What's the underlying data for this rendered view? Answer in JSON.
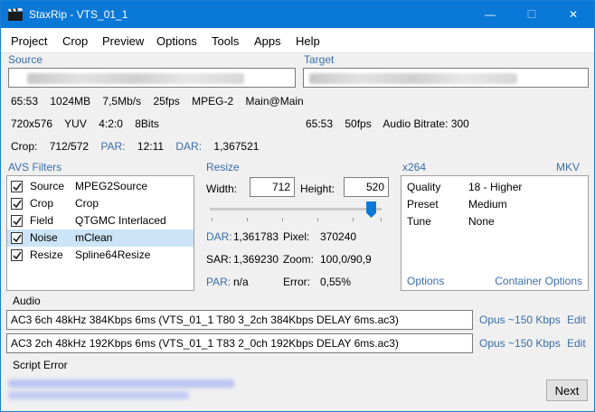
{
  "window": {
    "title": "StaxRip - VTS_01_1",
    "min_glyph": "—",
    "max_glyph": "☐",
    "close_glyph": "✕"
  },
  "menu": [
    "Project",
    "Crop",
    "Preview",
    "Options",
    "Tools",
    "Apps",
    "Help"
  ],
  "source": {
    "label": "Source",
    "line1": [
      "65:53",
      "1024MB",
      "7,5Mb/s",
      "25fps",
      "MPEG-2",
      "Main@Main"
    ],
    "line2": [
      "720x576",
      "YUV",
      "4:2:0",
      "8Bits"
    ],
    "crop_label": "Crop:",
    "crop_value": "712/572",
    "par_label": "PAR:",
    "par_value": "12:11",
    "dar_label": "DAR:",
    "dar_value": "1,367521"
  },
  "target": {
    "label": "Target",
    "info": [
      "65:53",
      "50fps",
      "Audio Bitrate: 300"
    ]
  },
  "filters": {
    "label": "AVS Filters",
    "rows": [
      {
        "name": "Source",
        "value": "MPEG2Source",
        "checked": true
      },
      {
        "name": "Crop",
        "value": "Crop",
        "checked": true
      },
      {
        "name": "Field",
        "value": "QTGMC Interlaced",
        "checked": true
      },
      {
        "name": "Noise",
        "value": "mClean",
        "checked": true
      },
      {
        "name": "Resize",
        "value": "Spline64Resize",
        "checked": true
      }
    ]
  },
  "resize": {
    "label": "Resize",
    "width_label": "Width:",
    "width_value": "712",
    "height_label": "Height:",
    "height_value": "520",
    "slider_fraction": 0.94,
    "dar_label": "DAR:",
    "dar_value": "1,361783",
    "pixel_label": "Pixel:",
    "pixel_value": "370240",
    "sar_label": "SAR:",
    "sar_value": "1,369230",
    "zoom_label": "Zoom:",
    "zoom_value": "100,0/90,9",
    "par_label": "PAR:",
    "par_value": "n/a",
    "error_label": "Error:",
    "error_value": "0,55%"
  },
  "encoder": {
    "label": "x264",
    "container": "MKV",
    "rows": [
      {
        "name": "Quality",
        "value": "18 - Higher"
      },
      {
        "name": "Preset",
        "value": "Medium"
      },
      {
        "name": "Tune",
        "value": "None"
      }
    ],
    "options_link": "Options",
    "container_options_link": "Container Options"
  },
  "audio": {
    "label": "Audio",
    "tracks": [
      {
        "file": "AC3 6ch 48kHz 384Kbps 6ms (VTS_01_1 T80 3_2ch 384Kbps DELAY 6ms.ac3)",
        "codec": "Opus ~150 Kbps",
        "edit": "Edit"
      },
      {
        "file": "AC3 2ch 48kHz 192Kbps 6ms (VTS_01_1 T83 2_0ch 192Kbps DELAY 6ms.ac3)",
        "codec": "Opus ~150 Kbps",
        "edit": "Edit"
      }
    ]
  },
  "script_error": {
    "label": "Script Error"
  },
  "next_button": "Next"
}
